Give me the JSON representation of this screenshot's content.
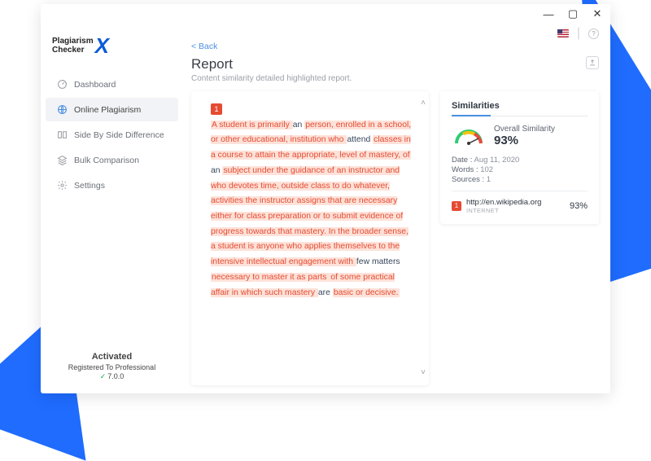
{
  "app": {
    "name_line1": "Plagiarism",
    "name_line2": "Checker",
    "logo_x": "X"
  },
  "window_controls": {
    "minimize": "—",
    "maximize": "▢",
    "close": "✕"
  },
  "nav": {
    "dashboard": "Dashboard",
    "online_plagiarism": "Online Plagiarism",
    "side_by_side": "Side By Side Difference",
    "bulk": "Bulk Comparison",
    "settings": "Settings"
  },
  "activation": {
    "title": "Activated",
    "sub": "Registered To Professional",
    "version": "7.0.0"
  },
  "header": {
    "back": "<  Back",
    "title": "Report",
    "subtitle": "Content similarity detailed highlighted report."
  },
  "report": {
    "badge": "1",
    "segments": [
      {
        "t": "A student is primarily ",
        "c": "hl"
      },
      {
        "t": "an ",
        "c": "plain"
      },
      {
        "t": "person, enrolled in a school, or other educational, institution who ",
        "c": "hl"
      },
      {
        "t": "attend ",
        "c": "plain"
      },
      {
        "t": "classes in a course to attain the appropriate, level of mastery, of ",
        "c": "hl"
      },
      {
        "t": "an ",
        "c": "plain"
      },
      {
        "t": "subject under the guidance of an instructor and who devotes time, outside class to do whatever, activities the instructor assigns that are necessary either for class preparation or to submit evidence of progress towards that mastery. In the broader sense, a student is anyone who applies themselves to the intensive intellectual engagement with ",
        "c": "hl"
      },
      {
        "t": "few matters ",
        "c": "plain"
      },
      {
        "t": "necessary to master it as parts ",
        "c": "hl"
      },
      {
        "t": "of some practical affair in which such mastery ",
        "c": "hl"
      },
      {
        "t": "are ",
        "c": "plain"
      },
      {
        "t": "basic or decisive.",
        "c": "hl"
      }
    ]
  },
  "similarities": {
    "title": "Similarities",
    "overall_label": "Overall Similarity",
    "overall_value": "93%",
    "date_label": "Date :",
    "date_value": "Aug 11, 2020",
    "words_label": "Words :",
    "words_value": "102",
    "sources_label": "Sources :",
    "sources_value": "1",
    "source": {
      "badge": "1",
      "url": "http://en.wikipedia.org",
      "type": "INTERNET",
      "percent": "93%"
    }
  },
  "help_glyph": "?"
}
